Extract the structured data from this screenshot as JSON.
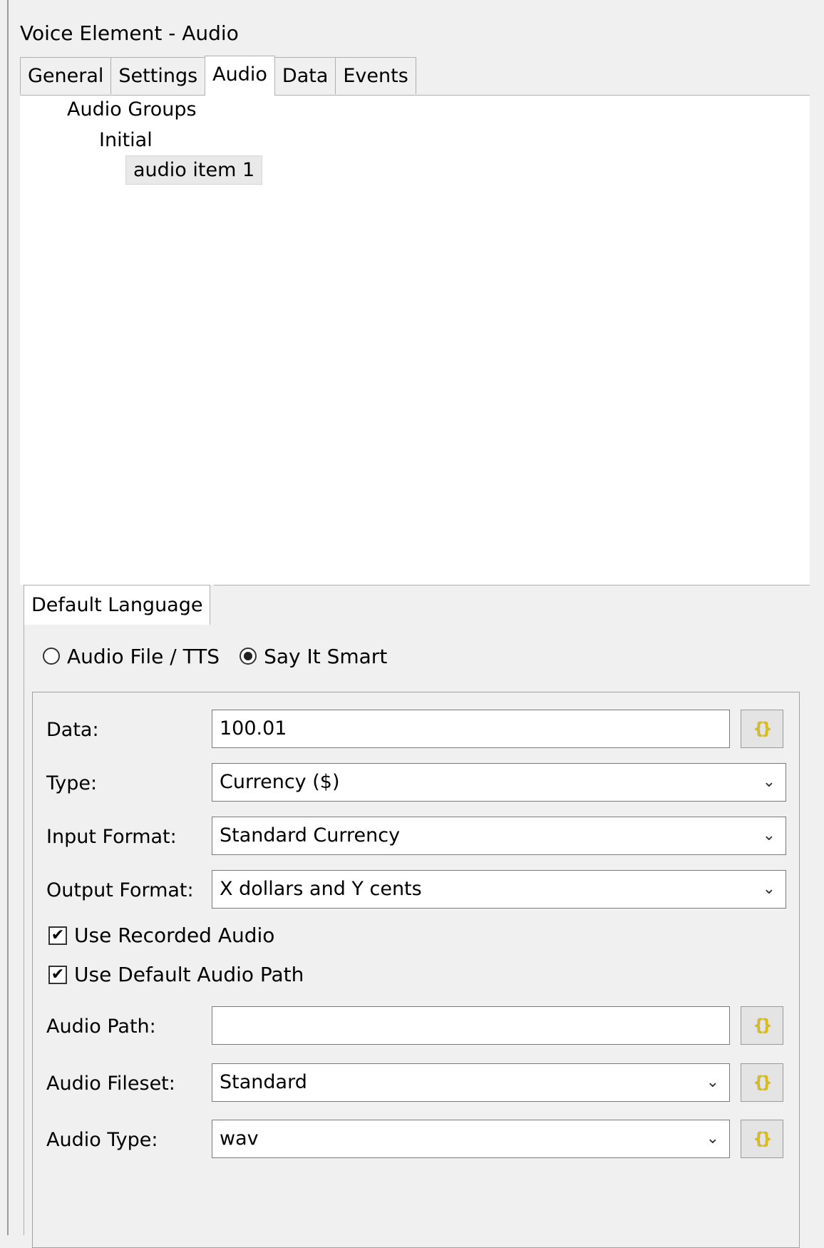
{
  "window_title": "Voice Element - Audio",
  "tabs": [
    "General",
    "Settings",
    "Audio",
    "Data",
    "Events"
  ],
  "tree": {
    "root": "Audio Groups",
    "group": "Initial",
    "item": "audio item 1"
  },
  "language_tab": "Default Language",
  "radio": {
    "option1": "Audio File / TTS",
    "option2": "Say It Smart",
    "selected": "Say It Smart"
  },
  "form": {
    "data_label": "Data:",
    "data_value": "100.01",
    "type_label": "Type:",
    "type_value": "Currency ($)",
    "input_format_label": "Input Format:",
    "input_format_value": "Standard Currency",
    "output_format_label": "Output Format:",
    "output_format_value": "X dollars and Y cents",
    "use_recorded_audio_label": "Use Recorded Audio",
    "use_recorded_audio_checked": true,
    "use_default_audio_path_label": "Use Default Audio Path",
    "use_default_audio_path_checked": true,
    "audio_path_label": "Audio Path:",
    "audio_path_value": "",
    "audio_fileset_label": "Audio Fileset:",
    "audio_fileset_value": "Standard",
    "audio_type_label": "Audio Type:",
    "audio_type_value": "wav"
  },
  "icons": {
    "expression_button": "expression-braces-icon",
    "dropdown": "chevron-down-icon",
    "check": "checkmark-icon"
  },
  "glyphs": {
    "expression": "{}",
    "chevron": "⌄",
    "check": "✔"
  },
  "colors": {
    "expression_icon": "#e0c000",
    "panel_background": "#f0f0f0",
    "content_background": "#ffffff"
  }
}
